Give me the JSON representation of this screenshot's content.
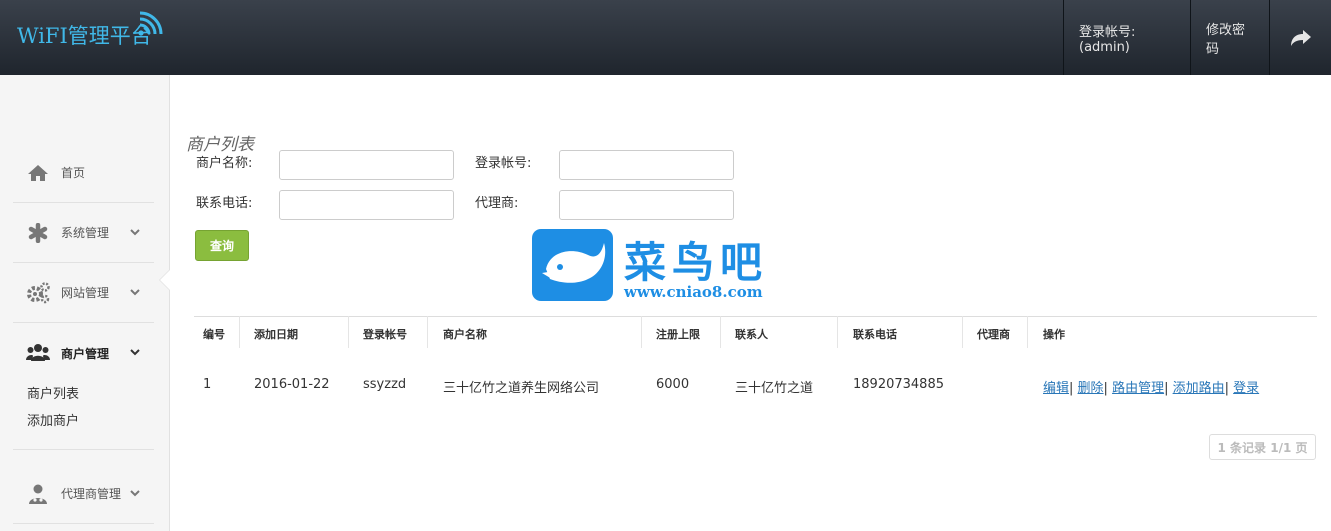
{
  "header": {
    "logo_text": "WiFI管理平台",
    "account_label": "登录帐号:(admin)",
    "change_password": "修改密码",
    "icons": {
      "logo": "wifi-signal-icon",
      "logout": "share-arrow-icon"
    }
  },
  "sidebar": {
    "items": [
      {
        "label": "首页",
        "icon": "home-icon"
      },
      {
        "label": "系统管理",
        "icon": "asterisk-icon"
      },
      {
        "label": "网站管理",
        "icon": "gears-icon"
      },
      {
        "label": "商户管理",
        "icon": "users-icon"
      },
      {
        "label": "代理商管理",
        "icon": "user-doctor-icon"
      }
    ],
    "sub_items": [
      "商户列表",
      "添加商户"
    ]
  },
  "main": {
    "title": "商户列表",
    "form": {
      "merchant_name_label": "商户名称:",
      "login_account_label": "登录帐号:",
      "phone_label": "联系电话:",
      "agent_label": "代理商:",
      "merchant_name_value": "",
      "login_account_value": "",
      "phone_value": "",
      "agent_value": "",
      "query_button": "查询"
    },
    "watermark": {
      "title": "菜鸟吧",
      "url": "www.cniao8.com"
    },
    "table": {
      "columns": [
        "编号",
        "添加日期",
        "登录帐号",
        "商户名称",
        "注册上限",
        "联系人",
        "联系电话",
        "代理商",
        "操作"
      ],
      "rows": [
        {
          "id": "1",
          "date": "2016-01-22",
          "account": "ssyzzd",
          "name": "三十亿竹之道养生网络公司",
          "limit": "6000",
          "contact": "三十亿竹之道",
          "phone": "18920734885",
          "agent": "",
          "actions": [
            "编辑",
            "删除",
            "路由管理",
            "添加路由",
            "登录"
          ]
        }
      ]
    },
    "pager": "1 条记录 1/1 页"
  },
  "colors": {
    "header": "#2b323b",
    "accent": "#40b8e8",
    "button": "#8bbd3f",
    "link": "#2a77b8"
  }
}
